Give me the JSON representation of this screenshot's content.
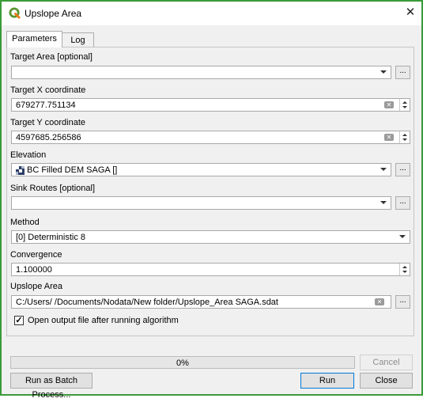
{
  "window": {
    "title": "Upslope Area",
    "close_symbol": "✕"
  },
  "tabs": [
    {
      "label": "Parameters",
      "active": true
    },
    {
      "label": "Log",
      "active": false
    }
  ],
  "params": {
    "target_area": {
      "label": "Target Area [optional]",
      "value": ""
    },
    "target_x": {
      "label": "Target X coordinate",
      "value": "679277.751134"
    },
    "target_y": {
      "label": "Target Y coordinate",
      "value": "4597685.256586"
    },
    "elevation": {
      "label": "Elevation",
      "value": "BC Filled DEM SAGA []",
      "icon": "raster-layer-icon"
    },
    "sink_routes": {
      "label": "Sink Routes [optional]",
      "value": ""
    },
    "method": {
      "label": "Method",
      "value": "[0] Deterministic 8"
    },
    "convergence": {
      "label": "Convergence",
      "value": "1.100000"
    },
    "upslope_area": {
      "label": "Upslope Area",
      "value": "C:/Users/       /Documents/Nodata/New folder/Upslope_Area SAGA.sdat"
    },
    "open_output": {
      "label": "Open output file after running algorithm",
      "checked": true,
      "mark": "✓"
    }
  },
  "browse_label": "...",
  "progress": {
    "value": 0,
    "text": "0%"
  },
  "buttons": {
    "cancel": "Cancel",
    "batch": "Run as Batch Process...",
    "run": "Run",
    "close": "Close"
  },
  "colors": {
    "window_border": "#3a9a3a",
    "progress_fill": "#06b025",
    "default_button_border": "#0078d7"
  }
}
